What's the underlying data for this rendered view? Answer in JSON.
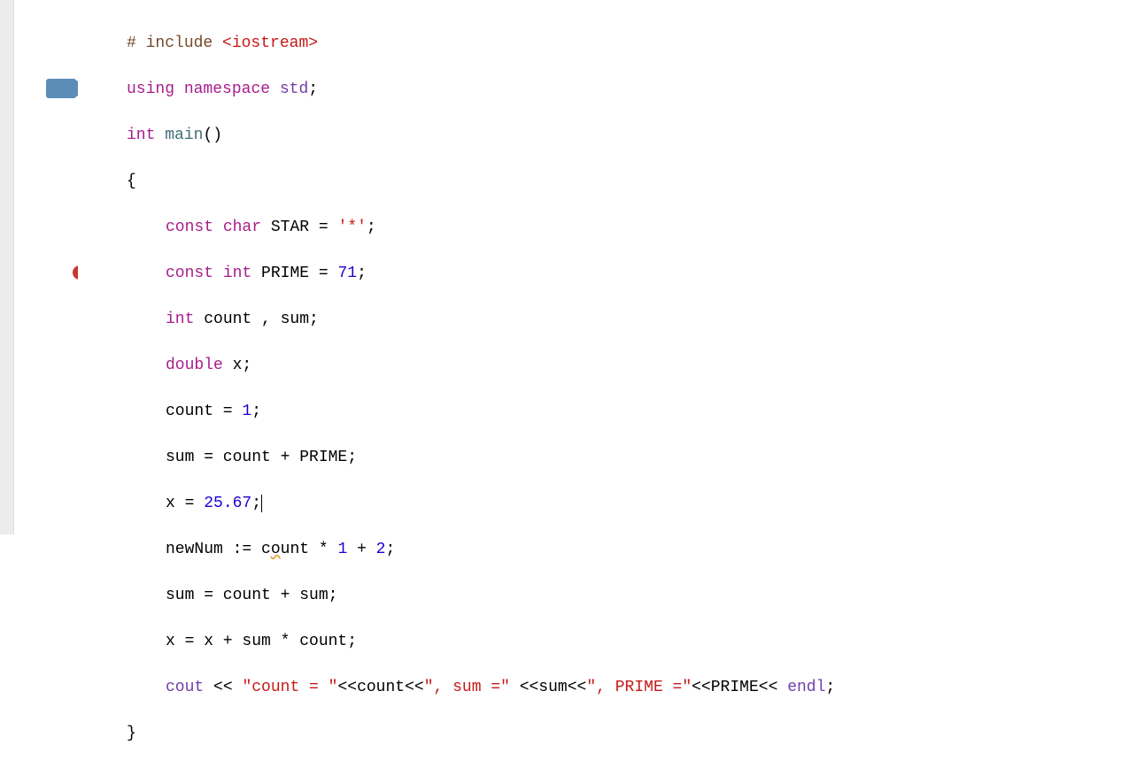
{
  "gutter": {
    "marker_line4": {
      "type": "current-line-arrow"
    },
    "marker_line12": {
      "type": "error-arrow"
    }
  },
  "code": {
    "l1": {
      "pp1": "# ",
      "pp2": "include ",
      "ang": "<iostream>"
    },
    "l2": {
      "kw1": "using",
      "sp1": " ",
      "kw2": "namespace",
      "sp2": " ",
      "id": "std",
      "p": ";"
    },
    "l3": {
      "kw": "int",
      "sp": " ",
      "fn": "main",
      "p": "()"
    },
    "l4": {
      "brace": "{"
    },
    "l5": {
      "kw1": "const",
      "sp1": " ",
      "kw2": "char",
      "sp2": " ",
      "id": "STAR = ",
      "str": "'*'",
      "p": ";"
    },
    "l6": {
      "kw1": "const",
      "sp1": " ",
      "kw2": "int",
      "sp2": " ",
      "id": "PRIME = ",
      "num": "71",
      "p": ";"
    },
    "l7": {
      "kw": "int",
      "sp": " ",
      "id": "count , sum;"
    },
    "l8": {
      "kw": "double",
      "sp": " ",
      "id": "x;"
    },
    "l9": {
      "id": "count = ",
      "num": "1",
      "p": ";"
    },
    "l10": {
      "t": "sum = count + PRIME;"
    },
    "l11": {
      "id": "x = ",
      "num": "25.67",
      "p": ";"
    },
    "l12": {
      "id1": "newNum := c",
      "wavy": "o",
      "id2": "unt * ",
      "num1": "1",
      "mid": " + ",
      "num2": "2",
      "p": ";"
    },
    "l13": {
      "t": "sum = count + sum;"
    },
    "l14": {
      "t": "x = x + sum * count;"
    },
    "l15": {
      "id1": "cout",
      "p1": " << ",
      "s1": "\"count = \"",
      "p2": "<<count<<",
      "s2": "\", sum =\"",
      "p3": " <<sum<<",
      "s3": "\", PRIME =\"",
      "p4": "<<PRIME<< ",
      "id2": "endl",
      "p5": ";"
    },
    "l16": {
      "brace": "}"
    }
  }
}
